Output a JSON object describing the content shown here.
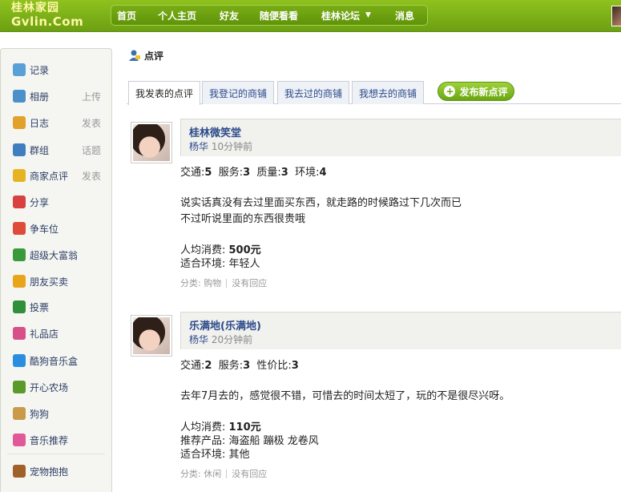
{
  "header": {
    "logo_line1": "桂林家园",
    "logo_line2": "Gvlin.Com",
    "nav": [
      {
        "label": "首页"
      },
      {
        "label": "个人主页"
      },
      {
        "label": "好友"
      },
      {
        "label": "随便看看"
      },
      {
        "label": "桂林论坛"
      },
      {
        "label": "消息"
      }
    ]
  },
  "sidebar": {
    "items": [
      {
        "label": "记录",
        "extra": "",
        "icon": "speech-bubble-icon",
        "color": "#5aa0d8"
      },
      {
        "label": "相册",
        "extra": "上传",
        "icon": "photo-album-icon",
        "color": "#4c8fc9"
      },
      {
        "label": "日志",
        "extra": "发表",
        "icon": "journal-icon",
        "color": "#e0a22a"
      },
      {
        "label": "群组",
        "extra": "话题",
        "icon": "group-icon",
        "color": "#3f7fc0"
      },
      {
        "label": "商家点评",
        "extra": "发表",
        "icon": "coins-icon",
        "color": "#e6b422"
      },
      {
        "label": "分享",
        "extra": "",
        "icon": "heart-share-icon",
        "color": "#d94040"
      },
      {
        "label": "争车位",
        "extra": "",
        "icon": "parking-icon",
        "color": "#e04a3a"
      },
      {
        "label": "超级大富翁",
        "extra": "",
        "icon": "monopoly-icon",
        "color": "#3a9a3a"
      },
      {
        "label": "朋友买卖",
        "extra": "",
        "icon": "coin-stack-icon",
        "color": "#e8a51c"
      },
      {
        "label": "投票",
        "extra": "",
        "icon": "bar-chart-icon",
        "color": "#2f8f3a"
      },
      {
        "label": "礼品店",
        "extra": "",
        "icon": "gift-shop-icon",
        "color": "#d8508a"
      },
      {
        "label": "酷狗音乐盒",
        "extra": "",
        "icon": "kugou-icon",
        "color": "#2a8ee0"
      },
      {
        "label": "开心农场",
        "extra": "",
        "icon": "sprout-icon",
        "color": "#5a9a2a"
      },
      {
        "label": "狗狗",
        "extra": "",
        "icon": "dog-icon",
        "color": "#c89a4a"
      },
      {
        "label": "音乐推荐",
        "extra": "",
        "icon": "music-note-icon",
        "color": "#e05a9a"
      },
      {
        "label": "宠物抱抱",
        "extra": "",
        "icon": "paw-icon",
        "color": "#a0602a"
      }
    ]
  },
  "main": {
    "title": "点评",
    "tabs": [
      {
        "label": "我发表的点评",
        "active": true
      },
      {
        "label": "我登记的商铺",
        "active": false
      },
      {
        "label": "我去过的商铺",
        "active": false
      },
      {
        "label": "我想去的商铺",
        "active": false
      }
    ],
    "publish_button": "发布新点评",
    "reviews": [
      {
        "shop": "桂林微笑堂",
        "user": "杨华",
        "time": "10分钟前",
        "ratings": [
          {
            "label": "交通:",
            "value": "5"
          },
          {
            "label": "服务:",
            "value": "3"
          },
          {
            "label": "质量:",
            "value": "3"
          },
          {
            "label": "环境:",
            "value": "4"
          }
        ],
        "content": [
          "说实话真没有去过里面买东西，就走路的时候路过下几次而已",
          "不过听说里面的东西很贵哦"
        ],
        "details": [
          {
            "label": "人均消费: ",
            "value": "500元",
            "bold": true
          },
          {
            "label": "适合环境: ",
            "value": "年轻人",
            "bold": false
          }
        ],
        "category": "分类: 购物",
        "reply": "没有回应"
      },
      {
        "shop": "乐满地(乐满地)",
        "user": "杨华",
        "time": "20分钟前",
        "ratings": [
          {
            "label": "交通:",
            "value": "2"
          },
          {
            "label": "服务:",
            "value": "3"
          },
          {
            "label": "性价比:",
            "value": "3"
          }
        ],
        "content": [
          "去年7月去的，感觉很不错，可惜去的时间太短了，玩的不是很尽兴呀。"
        ],
        "details": [
          {
            "label": "人均消费: ",
            "value": "110元",
            "bold": true
          },
          {
            "label": "推荐产品: ",
            "value": "海盗船 蹦极 龙卷风",
            "bold": false
          },
          {
            "label": "适合环境: ",
            "value": "其他",
            "bold": false
          }
        ],
        "category": "分类: 休闲",
        "reply": "没有回应"
      }
    ]
  }
}
